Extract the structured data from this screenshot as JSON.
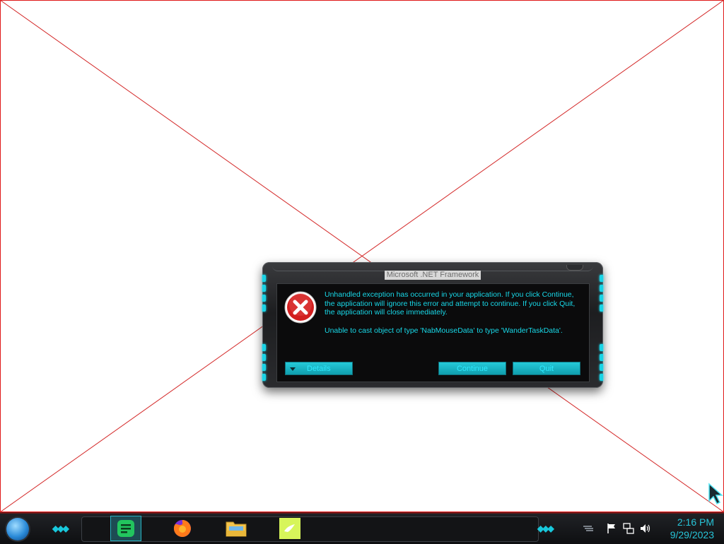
{
  "dialog": {
    "title": "Microsoft .NET Framework",
    "message_1": "Unhandled exception has occurred in your application. If you click Continue, the application will ignore this error and attempt to continue. If you click Quit, the application will close immediately.",
    "message_2": "Unable to cast object of type 'NabMouseData' to type 'WanderTaskData'.",
    "details_label": "Details",
    "continue_label": "Continue",
    "quit_label": "Quit",
    "accent_color": "#18d8e8"
  },
  "taskbar": {
    "apps": [
      {
        "name": "notes",
        "icon": "green-note-icon",
        "active": true
      },
      {
        "name": "firefox",
        "icon": "firefox-icon",
        "active": false
      },
      {
        "name": "file-explorer",
        "icon": "folder-icon",
        "active": false
      },
      {
        "name": "app",
        "icon": "yellow-bird-icon",
        "active": false
      }
    ],
    "clock": {
      "time": "2:16 PM",
      "date": "9/29/2023"
    }
  }
}
